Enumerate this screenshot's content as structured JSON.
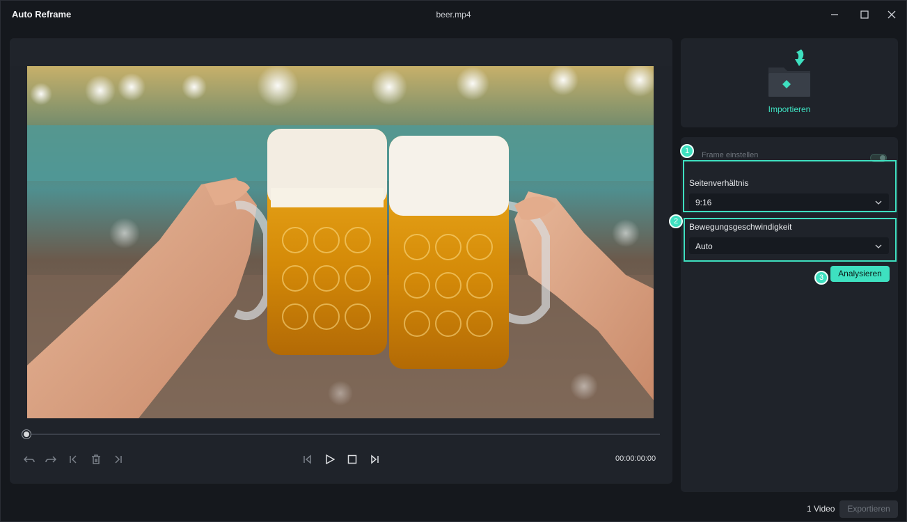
{
  "window": {
    "app_title": "Auto Reframe",
    "file_name": "beer.mp4"
  },
  "preview": {
    "timecode": "00:00:00:00",
    "playback_progress": 0
  },
  "import": {
    "label": "Importieren"
  },
  "settings": {
    "reframe_label": "Frame einstellen",
    "reframe_enabled": true,
    "aspect_ratio": {
      "label": "Seitenverhältnis",
      "value": "9:16"
    },
    "motion_speed": {
      "label": "Bewegungsgeschwindigkeit",
      "value": "Auto"
    },
    "analyze_label": "Analysieren",
    "steps": [
      "1",
      "2",
      "3"
    ]
  },
  "footer": {
    "video_count": "1 Video",
    "export_label": "Exportieren"
  },
  "colors": {
    "accent": "#3ee0c0",
    "panel": "#1f232a",
    "background": "#15181d"
  }
}
